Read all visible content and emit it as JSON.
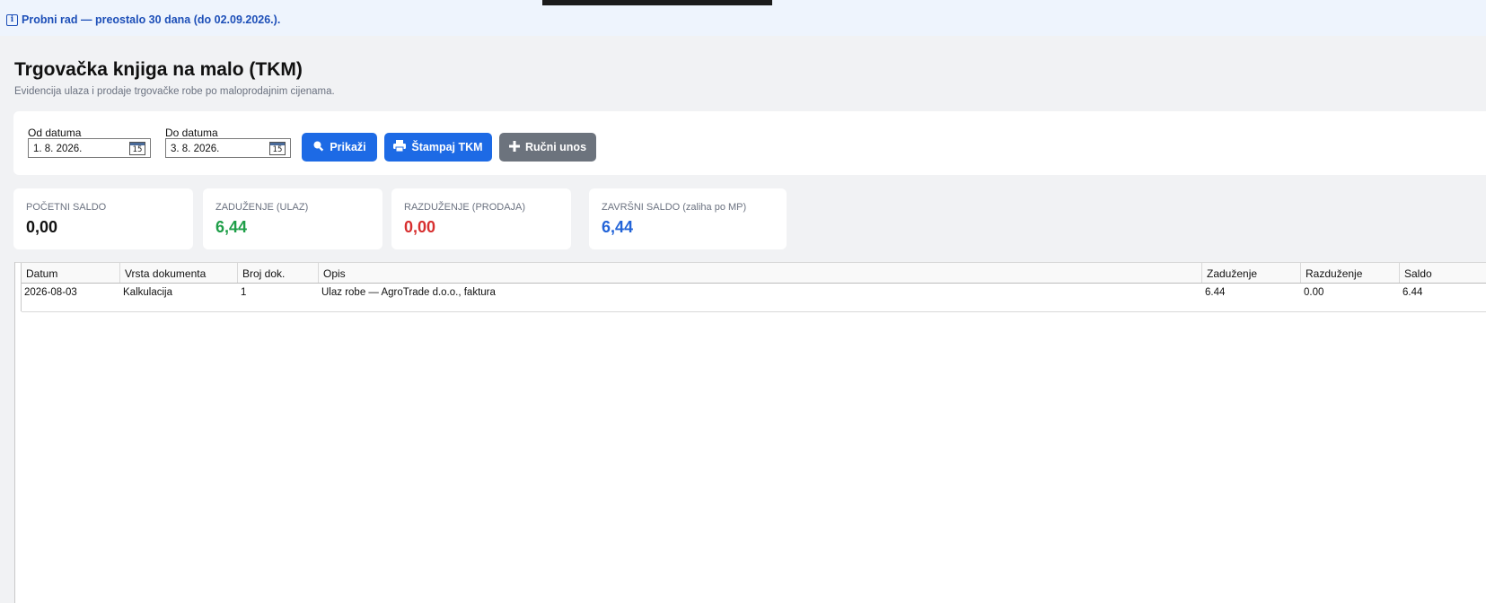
{
  "trial_banner": {
    "icon": "info-icon",
    "text": "Probni rad — preostalo 30 dana (do 02.09.2026.)."
  },
  "page": {
    "title": "Trgovačka knjiga na malo (TKM)",
    "subtitle": "Evidencija ulaza i prodaje trgovačke robe po maloprodajnim cijenama."
  },
  "filters": {
    "from_label": "Od datuma",
    "from_value": "1. 8. 2026.",
    "to_label": "Do datuma",
    "to_value": "3. 8. 2026.",
    "calendar_day": "15"
  },
  "buttons": {
    "show": "Prikaži",
    "print": "Štampaj TKM",
    "manual": "Ručni unos"
  },
  "stats": [
    {
      "label": "POČETNI SALDO",
      "value": "0,00",
      "color": "#111111"
    },
    {
      "label": "ZADUŽENJE (ULAZ)",
      "value": "6,44",
      "color": "#1e9e48"
    },
    {
      "label": "RAZDUŽENJE (PRODAJA)",
      "value": "0,00",
      "color": "#d72f2f"
    },
    {
      "label": "ZAVRŠNI SALDO (zaliha po MP)",
      "value": "6,44",
      "color": "#2364d8"
    }
  ],
  "table": {
    "columns": [
      "Datum",
      "Vrsta dokumenta",
      "Broj dok.",
      "Opis",
      "Zaduženje",
      "Razduženje",
      "Saldo"
    ],
    "rows": [
      [
        "2026-08-03",
        "Kalkulacija",
        "1",
        "Ulaz robe — AgroTrade d.o.o., faktura",
        "6.44",
        "0.00",
        "6.44"
      ]
    ]
  }
}
